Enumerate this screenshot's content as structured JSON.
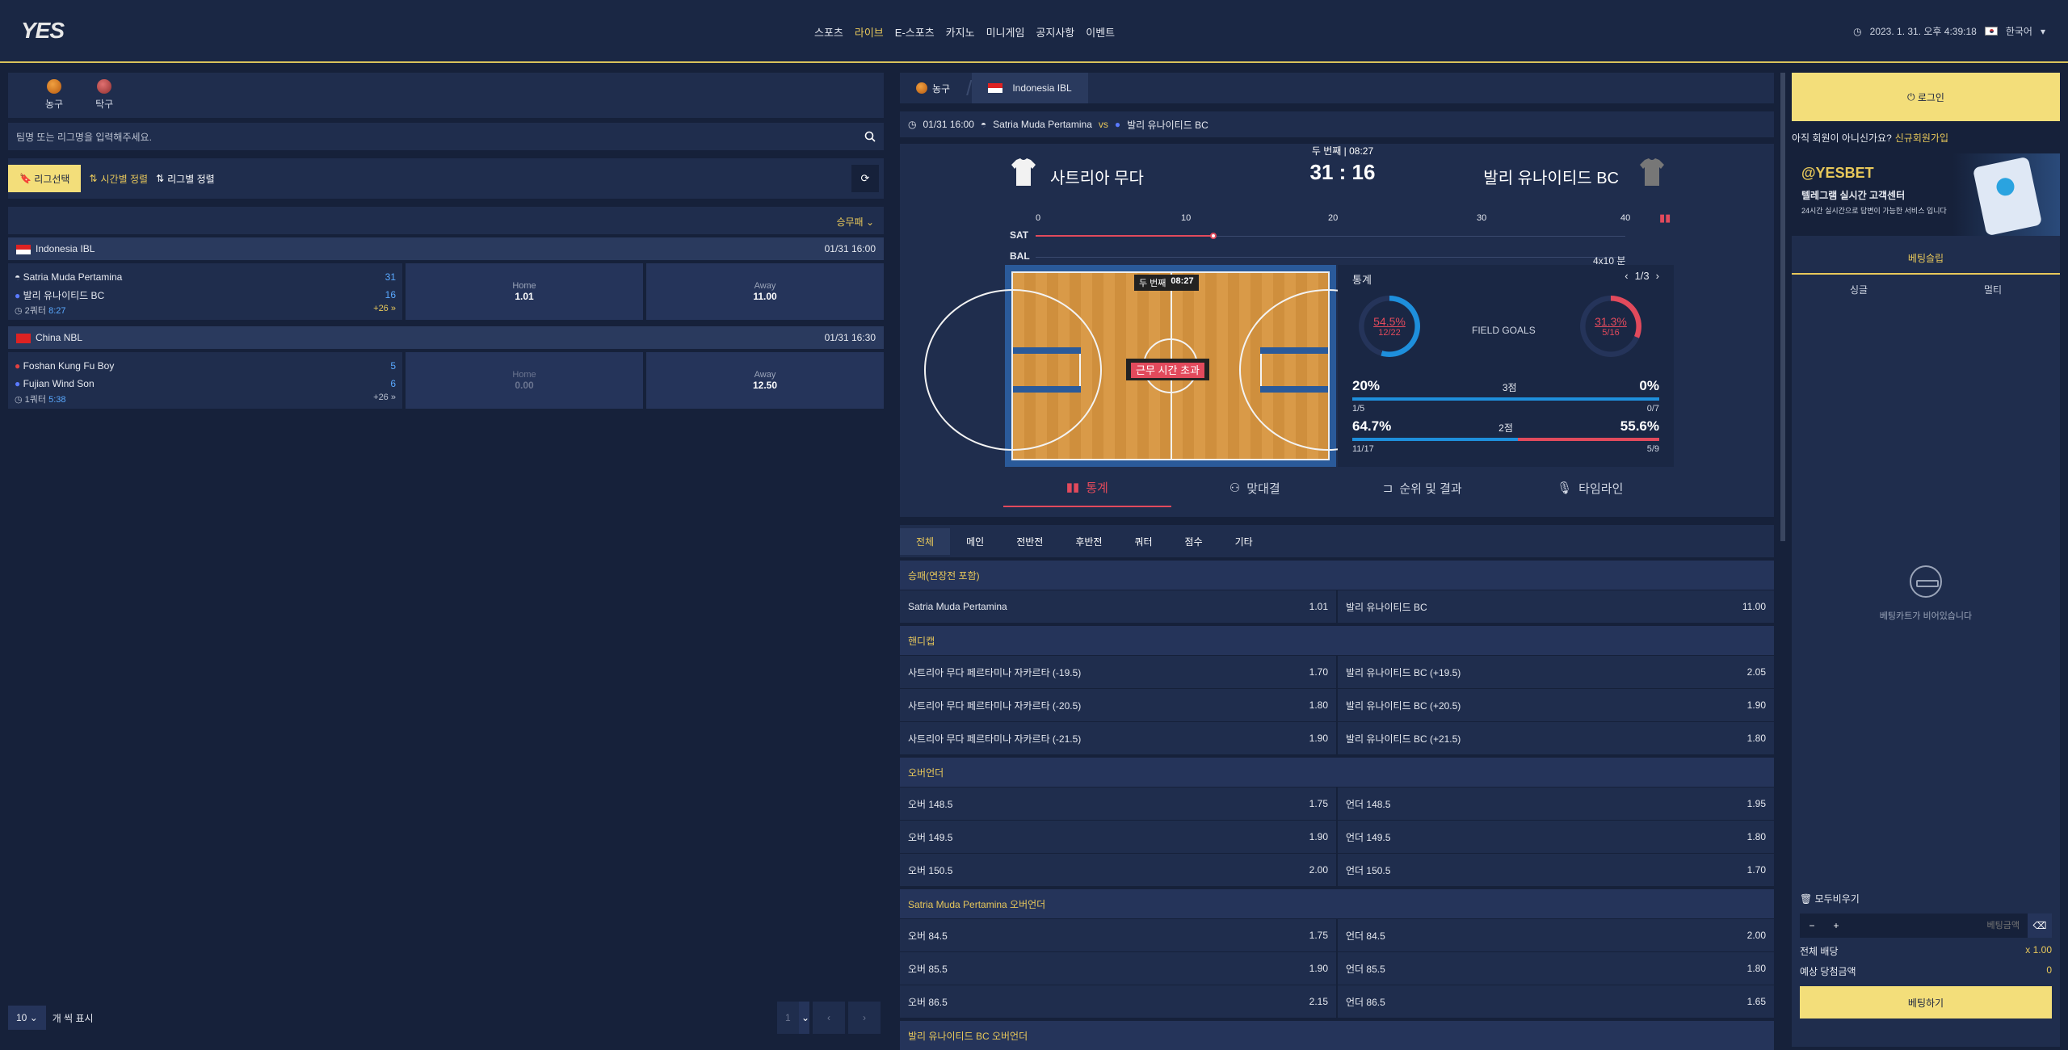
{
  "header": {
    "logo": "YES",
    "nav": [
      "스포츠",
      "라이브",
      "E-스포츠",
      "카지노",
      "미니게임",
      "공지사항",
      "이벤트"
    ],
    "active_nav": "라이브",
    "datetime": "2023. 1. 31. 오후 4:39:18",
    "language": "한국어"
  },
  "left": {
    "sports": [
      {
        "label": "농구",
        "icon": "basketball-icon"
      },
      {
        "label": "탁구",
        "icon": "table-tennis-icon"
      }
    ],
    "search_placeholder": "팀명 또는 리그명을 입력해주세요.",
    "filters": [
      "리그선택",
      "시간별 정렬",
      "리그별 정렬"
    ],
    "sort": "승무패",
    "leagues": [
      {
        "name": "Indonesia IBL",
        "time": "01/31 16:00",
        "home": "Satria Muda Pertamina",
        "away": "발리 유나이티드 BC",
        "home_score": "31",
        "away_score": "16",
        "period": "2쿼터",
        "clock": "8:27",
        "more": "+26",
        "home_label": "Home",
        "home_odd": "1.01",
        "away_label": "Away",
        "away_odd": "11.00"
      },
      {
        "name": "China NBL",
        "time": "01/31 16:30",
        "home": "Foshan Kung Fu Boy",
        "away": "Fujian Wind Son",
        "home_score": "5",
        "away_score": "6",
        "period": "1쿼터",
        "clock": "5:38",
        "more": "+26",
        "home_label": "Home",
        "home_odd": "0.00",
        "away_label": "Away",
        "away_odd": "12.50"
      }
    ],
    "page_size": "10",
    "page_size_label": "개 씩 표시",
    "page": "1"
  },
  "mid": {
    "crumb_sport": "농구",
    "crumb_league": "Indonesia IBL",
    "match_time": "01/31 16:00",
    "home": "Satria Muda Pertamina",
    "vs": "vs",
    "away": "발리 유나이티드 BC",
    "home_kr": "사트리아 무다",
    "away_kr": "발리 유나이티드 BC",
    "period": "두 번째 | 08:27",
    "score": "31 : 16",
    "timeline_ticks": [
      "0",
      "10",
      "20",
      "30",
      "40"
    ],
    "timeline_home": "SAT",
    "timeline_away": "BAL",
    "timeline_format": "4x10 분",
    "court_period": "두 번째",
    "court_clock": "08:27",
    "court_status": "근무 시간 초과",
    "stats_title": "통계",
    "stats_page": "1/3",
    "fg_label": "FIELD GOALS",
    "fg_home_pct": "54.5%",
    "fg_home_ratio": "12/22",
    "fg_home_value": 54.5,
    "fg_away_pct": "31.3%",
    "fg_away_ratio": "5/16",
    "fg_away_value": 31.3,
    "three_label": "3점",
    "three_home_pct": "20%",
    "three_home_ratio": "1/5",
    "three_away_pct": "0%",
    "three_away_ratio": "0/7",
    "two_label": "2점",
    "two_home_pct": "64.7%",
    "two_home_ratio": "11/17",
    "two_away_pct": "55.6%",
    "two_away_ratio": "5/9",
    "subtabs": [
      "통계",
      "맞대결",
      "순위 및 결과",
      "타임라인"
    ],
    "market_tabs": [
      "전체",
      "메인",
      "전반전",
      "후반전",
      "쿼터",
      "점수",
      "기타"
    ],
    "markets": [
      {
        "title": "승패(연장전 포함)",
        "rows": [
          [
            "Satria Muda Pertamina",
            "1.01",
            "발리 유나이티드 BC",
            "11.00"
          ]
        ]
      },
      {
        "title": "핸디캡",
        "rows": [
          [
            "사트리아 무다 페르타미나 자카르타 (-19.5)",
            "1.70",
            "발리 유나이티드 BC (+19.5)",
            "2.05"
          ],
          [
            "사트리아 무다 페르타미나 자카르타 (-20.5)",
            "1.80",
            "발리 유나이티드 BC (+20.5)",
            "1.90"
          ],
          [
            "사트리아 무다 페르타미나 자카르타 (-21.5)",
            "1.90",
            "발리 유나이티드 BC (+21.5)",
            "1.80"
          ]
        ]
      },
      {
        "title": "오버언더",
        "rows": [
          [
            "오버 148.5",
            "1.75",
            "언더 148.5",
            "1.95"
          ],
          [
            "오버 149.5",
            "1.90",
            "언더 149.5",
            "1.80"
          ],
          [
            "오버 150.5",
            "2.00",
            "언더 150.5",
            "1.70"
          ]
        ]
      },
      {
        "title": "Satria Muda Pertamina 오버언더",
        "rows": [
          [
            "오버 84.5",
            "1.75",
            "언더 84.5",
            "2.00"
          ],
          [
            "오버 85.5",
            "1.90",
            "언더 85.5",
            "1.80"
          ],
          [
            "오버 86.5",
            "2.15",
            "언더 86.5",
            "1.65"
          ]
        ]
      },
      {
        "title": "발리 유나이티드 BC 오버언더",
        "rows": []
      }
    ]
  },
  "right": {
    "login": "로그인",
    "signup_q": "아직 회원이 아니신가요?",
    "signup_link": "신규회원가입",
    "promo_brand": "@YESBET",
    "promo_title": "텔레그램 실시간 고객센터",
    "promo_sub": "24시간 실시간으로 답변이 가능한 서비스 입니다",
    "slip_title": "베팅슬립",
    "slip_tabs": [
      "싱글",
      "멀티"
    ],
    "empty": "베팅카트가 비어있습니다",
    "clear": "모두비우기",
    "amount_placeholder": "베팅금액",
    "total_odds_label": "전체 배당",
    "total_odds": "x 1.00",
    "expected_label": "예상 당첨금액",
    "expected": "0",
    "bet_button": "베팅하기"
  }
}
